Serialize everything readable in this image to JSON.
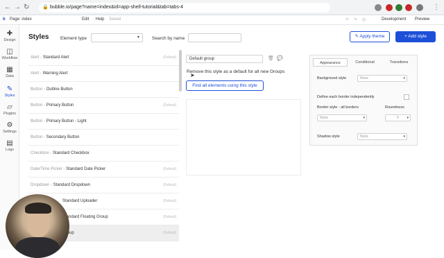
{
  "browser": {
    "url": "bubble.io/page?name=index&id=app-shell-tutorial&tab=tabs-4"
  },
  "topbar": {
    "page_label": "Page: index",
    "edit": "Edit",
    "help": "Help",
    "saved": "Saved",
    "environment": "Development",
    "preview": "Preview"
  },
  "sidebar": {
    "items": [
      {
        "label": "Design",
        "icon": "design-icon"
      },
      {
        "label": "Workflow",
        "icon": "workflow-icon"
      },
      {
        "label": "Data",
        "icon": "data-icon"
      },
      {
        "label": "Styles",
        "icon": "styles-icon"
      },
      {
        "label": "Plugins",
        "icon": "plugins-icon"
      },
      {
        "label": "Settings",
        "icon": "settings-icon"
      },
      {
        "label": "Logs",
        "icon": "logs-icon"
      }
    ]
  },
  "header": {
    "title": "Styles",
    "element_type_label": "Element type",
    "search_label": "Search by name",
    "apply_theme": "Apply theme",
    "add_style": "Add style"
  },
  "styles_list": [
    {
      "category": "Alert",
      "name": "Standard Alert",
      "default": "(Default)"
    },
    {
      "category": "Alert",
      "name": "Warning Alert",
      "default": ""
    },
    {
      "category": "Button",
      "name": "Outline Button",
      "default": ""
    },
    {
      "category": "Button",
      "name": "Primary Button",
      "default": "(Default)"
    },
    {
      "category": "Button",
      "name": "Primary Button - Light",
      "default": ""
    },
    {
      "category": "Button",
      "name": "Secondary Button",
      "default": ""
    },
    {
      "category": "Checkbox",
      "name": "Standard Checkbox",
      "default": ""
    },
    {
      "category": "Date/Time Picker",
      "name": "Standard Date Picker",
      "default": "(Default)"
    },
    {
      "category": "Dropdown",
      "name": "Standard Dropdown",
      "default": "(Default)"
    },
    {
      "category": "",
      "name": "Standard Uploader",
      "default": "(Default)"
    },
    {
      "category": "",
      "name": "Standard Floating Group",
      "default": "(Default)"
    },
    {
      "category": "",
      "name": "Group",
      "default": "(Default)"
    }
  ],
  "editor": {
    "style_name": "Default group",
    "default_text": "Remove this style as a default for all new Groups",
    "find_button": "Find all elements using this style"
  },
  "properties": {
    "tabs": [
      "Appearance",
      "Conditional",
      "Transitions"
    ],
    "background_style_label": "Background style",
    "background_style_value": "None",
    "each_border_label": "Define each border independently",
    "border_style_label": "Border style - all borders",
    "border_style_value": "None",
    "roundness_label": "Roundness",
    "roundness_value": "6",
    "shadow_style_label": "Shadow style",
    "shadow_style_value": "None"
  },
  "colors": {
    "accent": "#1d4fd8"
  }
}
